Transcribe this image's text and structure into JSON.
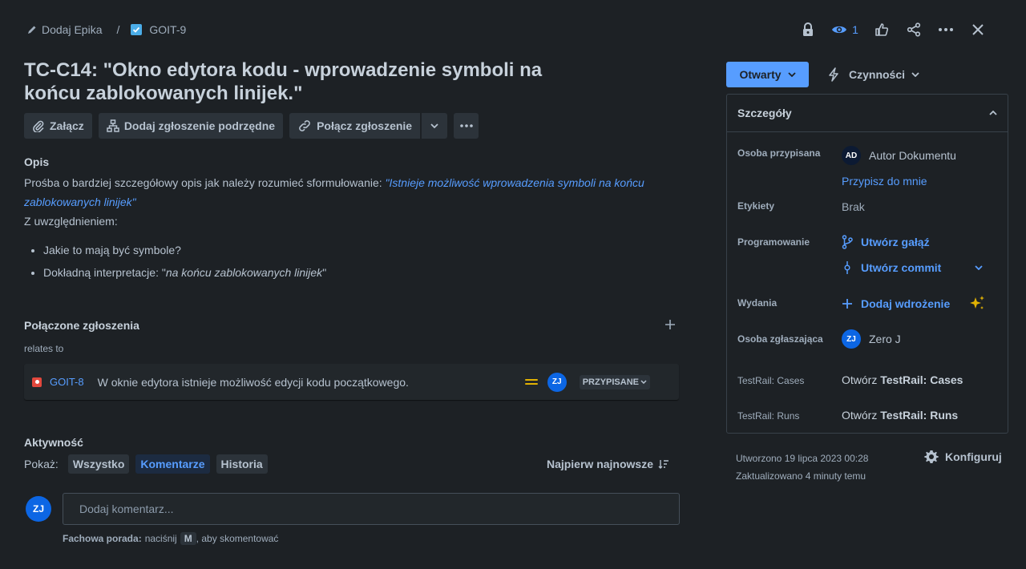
{
  "breadcrumb": {
    "add_epic": "Dodaj Epika",
    "separator": "/",
    "issue_key": "GOIT-9"
  },
  "top_actions": {
    "watch_count": "1"
  },
  "issue": {
    "title": "TC-C14: \"Okno edytora kodu - wprowadzenie symboli na końcu zablokowanych linijek.\""
  },
  "toolbar": {
    "attach": "Załącz",
    "add_child": "Dodaj zgłoszenie podrzędne",
    "link_issue": "Połącz zgłoszenie"
  },
  "description": {
    "heading": "Opis",
    "intro": "Prośba o bardziej szczegółowy opis jak należy rozumieć sformułowanie: ",
    "quote": "\"Istnieje możliwość wprowadzenia symboli na końcu zablokowanych linijek\"",
    "considering": "Z uwzględnieniem:",
    "bullet1": "Jakie to mają być symbole?",
    "bullet2_prefix": "Dokładną interpretacje: \"",
    "bullet2_em": "na końcu zablokowanych linijek",
    "bullet2_suffix": "\""
  },
  "linked": {
    "heading": "Połączone zgłoszenia",
    "relation": "relates to",
    "item": {
      "key": "GOIT-8",
      "summary": "W oknie edytora istnieje możliwość edycji kodu początkowego.",
      "assignee_initials": "ZJ",
      "status": "PRZYPISANE"
    }
  },
  "activity": {
    "heading": "Aktywność",
    "show_label": "Pokaż:",
    "filters": [
      "Wszystko",
      "Komentarze",
      "Historia"
    ],
    "active_filter": "Komentarze",
    "sort": "Najpierw najnowsze",
    "user_initials": "ZJ",
    "comment_placeholder": "Dodaj komentarz...",
    "tip_bold": "Fachowa porada:",
    "tip_press": "naciśnij",
    "tip_key": "M",
    "tip_rest": ", aby skomentować"
  },
  "status_button": {
    "label": "Otwarty"
  },
  "actions_button": {
    "label": "Czynności"
  },
  "details": {
    "heading": "Szczegóły",
    "assignee_label": "Osoba przypisana",
    "assignee_initials": "AD",
    "assignee_name": "Autor Dokumentu",
    "assign_to_me": "Przypisz do mnie",
    "labels_label": "Etykiety",
    "labels_value": "Brak",
    "dev_label": "Programowanie",
    "create_branch": "Utwórz gałąź",
    "create_commit": "Utwórz commit",
    "releases_label": "Wydania",
    "add_deployment": "Dodaj wdrożenie",
    "reporter_label": "Osoba zgłaszająca",
    "reporter_initials": "ZJ",
    "reporter_name": "Zero J",
    "testrail_cases_label": "TestRail: Cases",
    "testrail_cases_prefix": "Otwórz ",
    "testrail_cases_bold": "TestRail: Cases",
    "testrail_runs_label": "TestRail: Runs",
    "testrail_runs_prefix": "Otwórz ",
    "testrail_runs_bold": "TestRail: Runs"
  },
  "meta": {
    "created": "Utworzono 19 lipca 2023 00:28",
    "updated": "Zaktualizowano 4 minuty temu",
    "configure": "Konfiguruj"
  },
  "colors": {
    "background": "#1d2125",
    "link": "#579dff",
    "status_button": "#579dff",
    "bug": "#e2483d",
    "priority_medium": "#e2b203"
  }
}
